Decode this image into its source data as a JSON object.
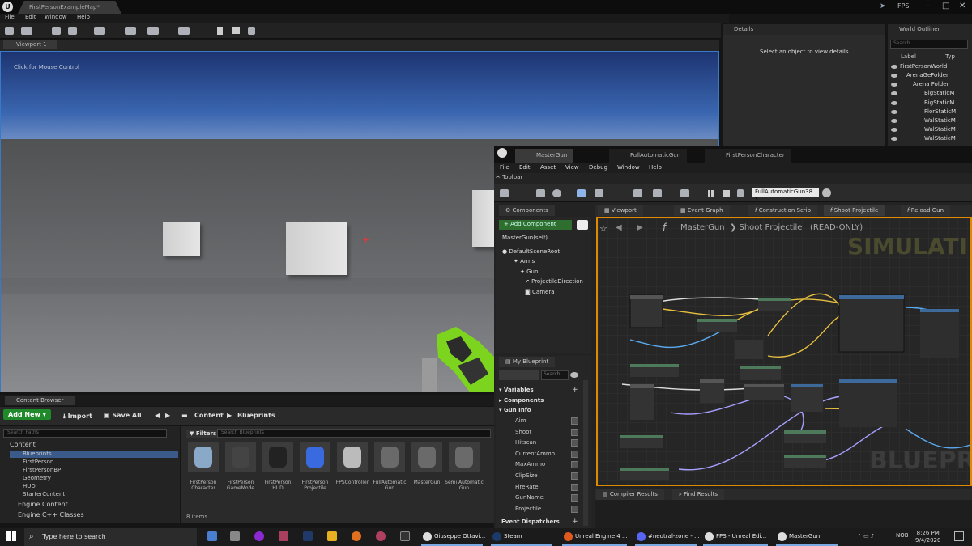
{
  "title_bar": {
    "tab": "FirstPersonExampleMap*",
    "fps": "FPS",
    "logo": "U"
  },
  "menu": [
    "File",
    "Edit",
    "Window",
    "Help"
  ],
  "viewport": {
    "tab": "Viewport 1",
    "hint": "Click for Mouse Control",
    "crosshair": "+"
  },
  "details": {
    "title": "Details",
    "message": "Select an object to view details."
  },
  "outliner": {
    "title": "World Outliner",
    "search_placeholder": "Search...",
    "col_label": "Label",
    "col_type": "Typ",
    "rows": [
      "FirstPersonWorld",
      "ArenaGeFolder",
      "Arena Folder",
      "BigStaticM",
      "BigStaticM",
      "FlorStaticM",
      "WalStaticM",
      "WalStaticM",
      "WalStaticM"
    ]
  },
  "content_browser": {
    "tab": "Content Browser",
    "add_new": "Add New",
    "import": "Import",
    "save_all": "Save All",
    "path": [
      "Content",
      "Blueprints"
    ],
    "search_paths": "Search Paths",
    "filters": "Filters",
    "search_blueprints": "Search Blueprints",
    "tree": [
      "Content",
      "Blueprints",
      "FirstPerson",
      "FirstPersonBP",
      "Geometry",
      "HUD",
      "StarterContent",
      "Engine Content",
      "Engine C++ Classes"
    ],
    "assets": [
      "FirstPerson Character",
      "FirstPerson GameMode",
      "FirstPerson HUD",
      "FirstPerson Projectile",
      "FPSController",
      "FullAutomatic Gun",
      "MasterGun",
      "Semi Automatic Gun"
    ],
    "count": "8 items"
  },
  "blueprint": {
    "tabs": [
      "MasterGun",
      "FullAutomaticGun",
      "FirstPersonCharacter"
    ],
    "menu": [
      "File",
      "Edit",
      "Asset",
      "View",
      "Debug",
      "Window",
      "Help"
    ],
    "toolbar_tab": "Toolbar",
    "debug_object": "FullAutomaticGun38",
    "components_tab": "Components",
    "add_component": "+ Add Component",
    "components": [
      "MasterGun(self)",
      "DefaultSceneRoot",
      "Arms",
      "Gun",
      "ProjectileDirection",
      "Camera"
    ],
    "my_blueprint": "My Blueprint",
    "search_placeholder": "Search",
    "variables": "Variables",
    "components_hdr": "Components",
    "gun_info": "Gun Info",
    "vars": [
      "Aim",
      "Shoot",
      "Hitscan",
      "CurrentAmmo",
      "MaxAmmo",
      "ClipSize",
      "FireRate",
      "GunName",
      "Projectile"
    ],
    "event_dispatchers": "Event Dispatchers",
    "graph_tabs": [
      "Viewport",
      "Event Graph",
      "Construction Scrip",
      "Shoot Projectile",
      "Reload Gun"
    ],
    "breadcrumb": [
      "MasterGun",
      "Shoot Projectile",
      "(READ-ONLY)"
    ],
    "simulating": "SIMULATI",
    "watermark": "BLUEPRI",
    "results_tabs": [
      "Compiler Results",
      "Find Results"
    ]
  },
  "taskbar": {
    "search": "Type here to search",
    "apps": [
      "Giuseppe Ottavi...",
      "Steam",
      "Unreal Engine 4 ...",
      "#neutral-zone - ...",
      "FPS - Unreal Edi...",
      "MasterGun"
    ],
    "lang": "NOB",
    "time": "8:26 PM",
    "date": "9/4/2020"
  }
}
